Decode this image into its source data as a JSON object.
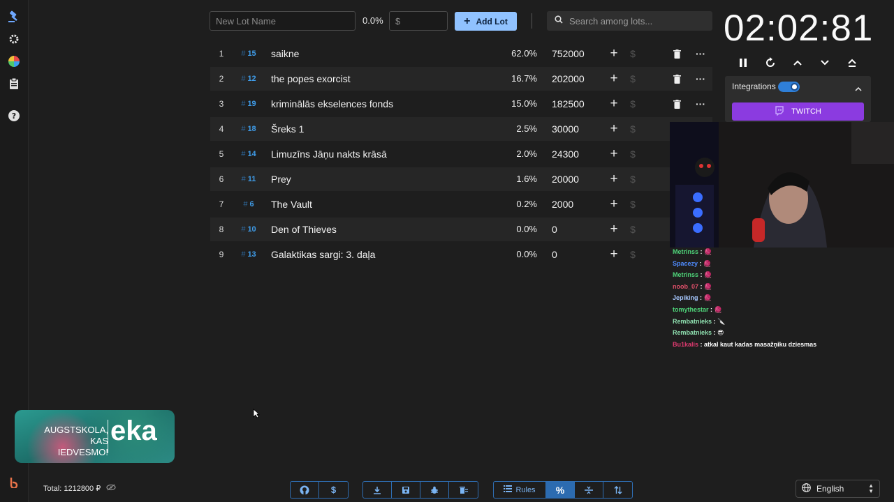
{
  "top": {
    "new_lot_placeholder": "New Lot Name",
    "percent_display": "0.0%",
    "amount_placeholder": "$",
    "add_lot_label": "Add Lot",
    "search_placeholder": "Search among lots..."
  },
  "lots": [
    {
      "index": "1",
      "id": "15",
      "name": "saikne",
      "percent": "62.0%",
      "amount": "752000"
    },
    {
      "index": "2",
      "id": "12",
      "name": "the popes exorcist",
      "percent": "16.7%",
      "amount": "202000"
    },
    {
      "index": "3",
      "id": "19",
      "name": "kriminālās ekselences fonds",
      "percent": "15.0%",
      "amount": "182500"
    },
    {
      "index": "4",
      "id": "18",
      "name": "Šreks 1",
      "percent": "2.5%",
      "amount": "30000"
    },
    {
      "index": "5",
      "id": "14",
      "name": "Limuzīns Jāņu nakts krāsā",
      "percent": "2.0%",
      "amount": "24300"
    },
    {
      "index": "6",
      "id": "11",
      "name": "Prey",
      "percent": "1.6%",
      "amount": "20000"
    },
    {
      "index": "7",
      "id": "6",
      "name": "The Vault",
      "percent": "0.2%",
      "amount": "2000"
    },
    {
      "index": "8",
      "id": "10",
      "name": "Den of Thieves",
      "percent": "0.0%",
      "amount": "0"
    },
    {
      "index": "9",
      "id": "13",
      "name": "Galaktikas sargi: 3. daļa",
      "percent": "0.0%",
      "amount": "0"
    }
  ],
  "timer": "02:02:81",
  "integrations": {
    "label": "Integrations",
    "enabled": true,
    "twitch_label": "TWITCH"
  },
  "chat": [
    {
      "user": "Metrinss",
      "color": "#4fd67a",
      "message": "🧶"
    },
    {
      "user": "Spacezy",
      "color": "#4f8cff",
      "message": "🧶"
    },
    {
      "user": "Metrinss",
      "color": "#4fd67a",
      "message": "🧶"
    },
    {
      "user": "noob_07",
      "color": "#e0506a",
      "message": "🧶"
    },
    {
      "user": "Jepiking",
      "color": "#a7c8ff",
      "message": "🧶"
    },
    {
      "user": "tomythestar",
      "color": "#4fd67a",
      "message": "🧶"
    },
    {
      "user": "Rembatnieks",
      "color": "#8fe0b0",
      "message": "🔪"
    },
    {
      "user": "Rembatnieks",
      "color": "#8fe0b0",
      "message": "😎"
    },
    {
      "user": "Bu1kalis",
      "color": "#e03a70",
      "message": "atkal kaut kadas masažņiku dziesmas"
    }
  ],
  "ad": {
    "line1": "AUGSTSKOLA, KAS",
    "line2": "IEDVESMO!",
    "brand": "eka"
  },
  "footer": {
    "total_label": "Total: 1212800 ₽",
    "rules_label": "Rules",
    "language": "English"
  },
  "colors": {
    "accent": "#90c2ff",
    "twitch": "#8b3be0",
    "id_blue": "#3f9dea",
    "background": "#1e1e1e"
  }
}
